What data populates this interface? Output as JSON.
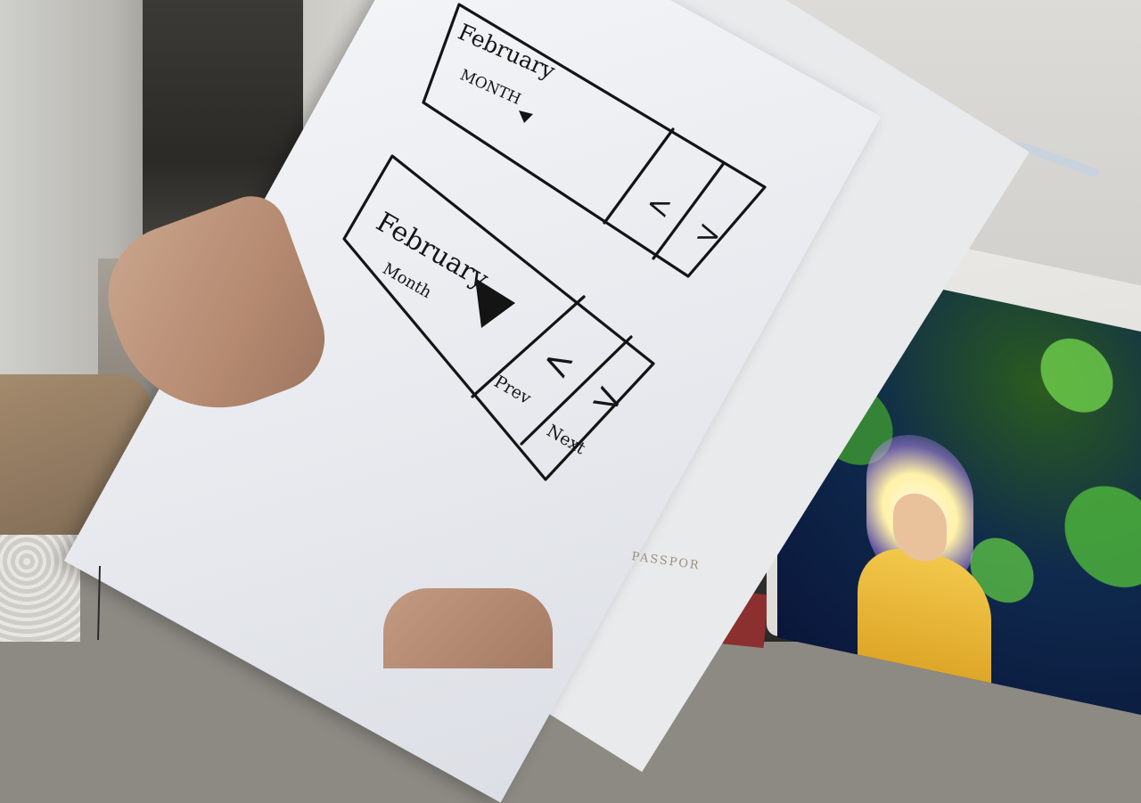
{
  "sketch_top": {
    "month_value": "February",
    "month_label": "MONTH",
    "prev_glyph": "<",
    "next_glyph": ">"
  },
  "sketch_bottom": {
    "month_value": "February",
    "month_label": "Month",
    "prev_glyph": "<",
    "next_glyph": ">",
    "prev_label": "Prev",
    "next_label": "Next"
  },
  "background_text": {
    "passport": "PASSPOR"
  },
  "colors": {
    "ink": "#141414",
    "paper": "#eef0f3",
    "screen_accent": "#5bbf44"
  }
}
